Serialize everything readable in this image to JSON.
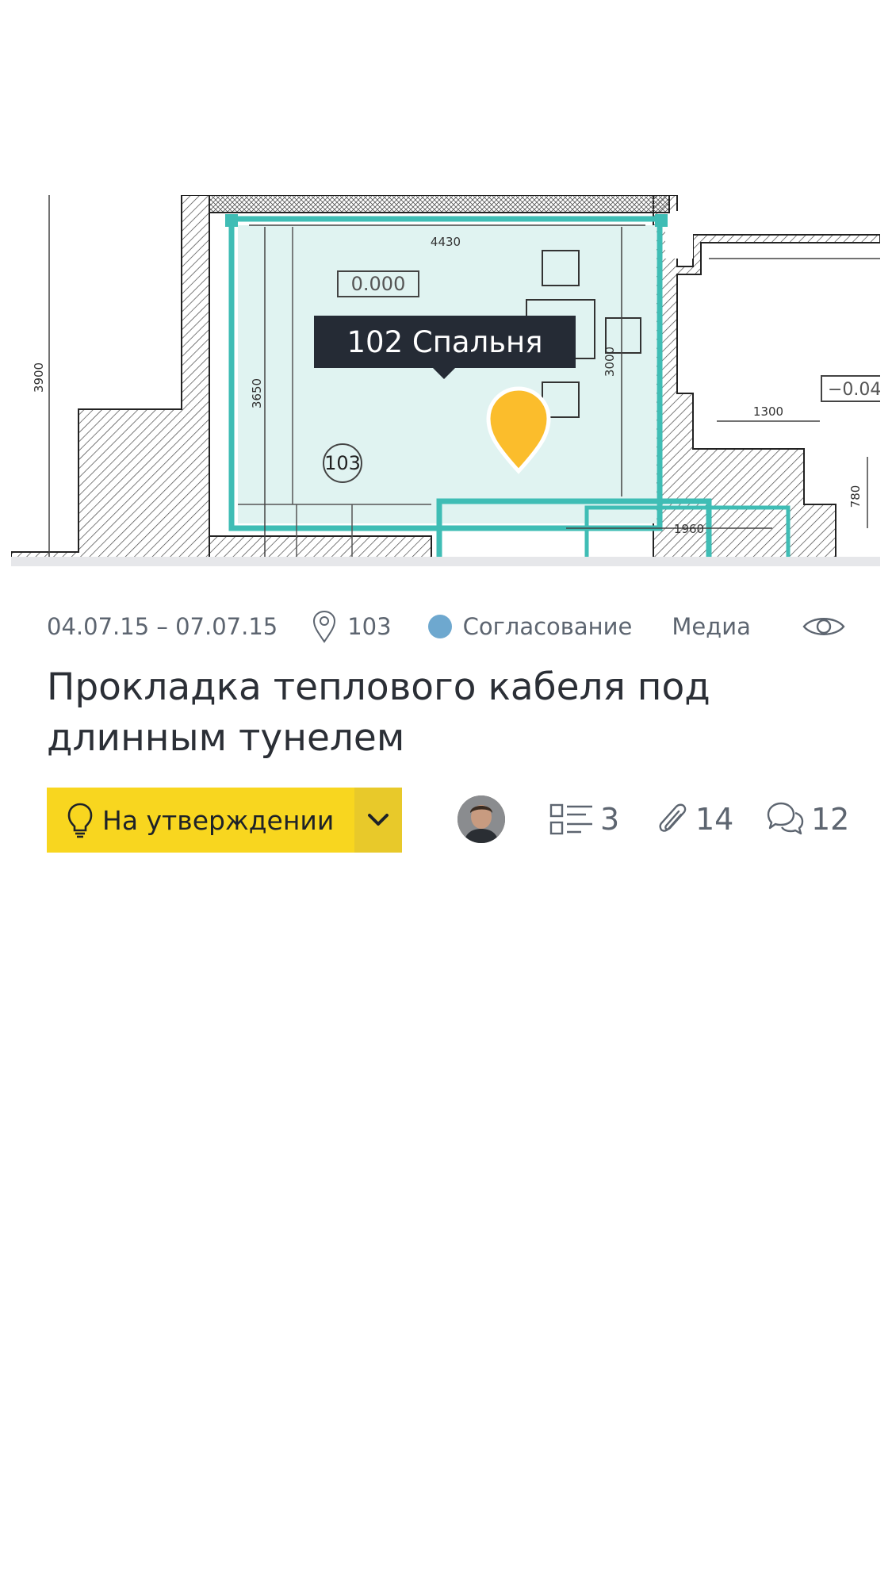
{
  "plan": {
    "room_tooltip": "102 Спальня",
    "room_number": "103",
    "level_mark": "0.000",
    "level_mark_right": "−0.04",
    "dimensions": [
      "4430",
      "3900",
      "3650",
      "3000",
      "1300",
      "780",
      "1960"
    ]
  },
  "task": {
    "dates": "04.07.15 – 07.07.15",
    "location": "103",
    "stage": "Согласование",
    "media": "Медиа",
    "title": "Прокладка теплового кабеля под длинным тунелем"
  },
  "status": {
    "label": "На утверждении"
  },
  "stats": {
    "checklist": "3",
    "attachments": "14",
    "comments": "12"
  },
  "colors": {
    "room_fill": "#e0f3f1",
    "room_outline": "#3fbdb5",
    "pin": "#fbbd2c",
    "status_button": "#f8d61f",
    "stage_dot": "#6ea8cf",
    "tooltip_bg": "#252b35"
  },
  "icons": [
    "location-pin-icon",
    "eye-icon",
    "lightbulb-icon",
    "chevron-down-icon",
    "checklist-icon",
    "paperclip-icon",
    "comments-icon"
  ]
}
